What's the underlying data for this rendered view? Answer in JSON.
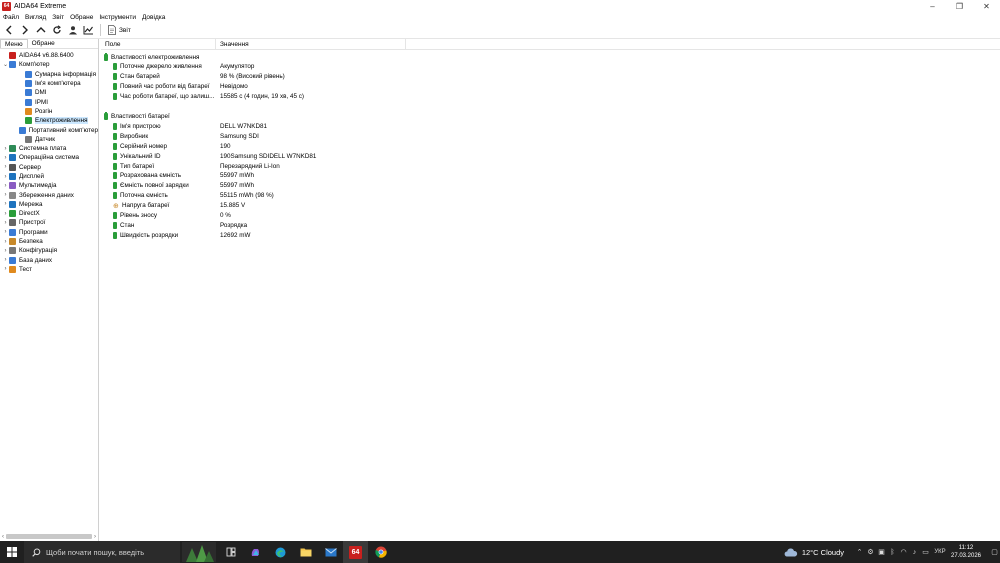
{
  "window": {
    "title": "AIDA64 Extreme",
    "icon_text": "64"
  },
  "menu": [
    "Файл",
    "Вигляд",
    "Звіт",
    "Обране",
    "Інструменти",
    "Довідка"
  ],
  "toolbar": {
    "report_label": "Звіт"
  },
  "left_pane": {
    "tabs": [
      "Меню",
      "Обране"
    ],
    "tree": [
      {
        "label": "AIDA64 v6.88.6400",
        "indent": 0,
        "expander": "",
        "icon_color": "#c8201e"
      },
      {
        "label": "Комп'ютер",
        "indent": 0,
        "expander": "⌄",
        "icon_color": "#3a7bd5"
      },
      {
        "label": "Сумарна інформація",
        "indent": 2,
        "expander": "",
        "icon_color": "#3a7bd5"
      },
      {
        "label": "Ім'я комп'ютера",
        "indent": 2,
        "expander": "",
        "icon_color": "#3a7bd5"
      },
      {
        "label": "DMI",
        "indent": 2,
        "expander": "",
        "icon_color": "#3a7bd5"
      },
      {
        "label": "IPMI",
        "indent": 2,
        "expander": "",
        "icon_color": "#3a7bd5"
      },
      {
        "label": "Розгін",
        "indent": 2,
        "expander": "",
        "icon_color": "#e08a1e"
      },
      {
        "label": "Електроживлення",
        "indent": 2,
        "expander": "",
        "icon_color": "#2a9d3a",
        "selected": true
      },
      {
        "label": "Портативний комп'ютер",
        "indent": 2,
        "expander": "",
        "icon_color": "#3a7bd5"
      },
      {
        "label": "Датчик",
        "indent": 2,
        "expander": "",
        "icon_color": "#777777"
      },
      {
        "label": "Системна плата",
        "indent": 0,
        "expander": "›",
        "icon_color": "#2e8b57"
      },
      {
        "label": "Операційна система",
        "indent": 0,
        "expander": "›",
        "icon_color": "#1e73be"
      },
      {
        "label": "Сервер",
        "indent": 0,
        "expander": "›",
        "icon_color": "#555555"
      },
      {
        "label": "Дисплей",
        "indent": 0,
        "expander": "›",
        "icon_color": "#1e73be"
      },
      {
        "label": "Мультимедіа",
        "indent": 0,
        "expander": "›",
        "icon_color": "#8a5cc2"
      },
      {
        "label": "Збереження даних",
        "indent": 0,
        "expander": "›",
        "icon_color": "#888888"
      },
      {
        "label": "Мережа",
        "indent": 0,
        "expander": "›",
        "icon_color": "#1e73be"
      },
      {
        "label": "DirectX",
        "indent": 0,
        "expander": "›",
        "icon_color": "#2a9d3a"
      },
      {
        "label": "Пристрої",
        "indent": 0,
        "expander": "›",
        "icon_color": "#666666"
      },
      {
        "label": "Програми",
        "indent": 0,
        "expander": "›",
        "icon_color": "#3a7bd5"
      },
      {
        "label": "Безпека",
        "indent": 0,
        "expander": "›",
        "icon_color": "#c8892a"
      },
      {
        "label": "Конфігурація",
        "indent": 0,
        "expander": "›",
        "icon_color": "#777777"
      },
      {
        "label": "База даних",
        "indent": 0,
        "expander": "›",
        "icon_color": "#3a7bd5"
      },
      {
        "label": "Тест",
        "indent": 0,
        "expander": "›",
        "icon_color": "#e08a1e"
      }
    ]
  },
  "columns": {
    "field": "Поле",
    "value": "Значення"
  },
  "groups": [
    {
      "title": "Властивості електроживлення",
      "rows": [
        {
          "field": "Поточне джерело живлення",
          "value": "Акумулятор",
          "icon": "battery-icon"
        },
        {
          "field": "Стан батарей",
          "value": "98 % (Високий рівень)",
          "icon": "battery-icon"
        },
        {
          "field": "Повний час роботи від батареї",
          "value": "Невідомо",
          "icon": "battery-icon"
        },
        {
          "field": "Час роботи батареї, що залиш...",
          "value": "15585 с (4 годин, 19 хв, 45 с)",
          "icon": "battery-icon"
        }
      ]
    },
    {
      "title": "Властивості батареї",
      "rows": [
        {
          "field": "Ім'я пристрою",
          "value": "DELL W7NKD81",
          "icon": "battery-icon"
        },
        {
          "field": "Виробник",
          "value": "Samsung SDI",
          "icon": "battery-icon"
        },
        {
          "field": "Серійний номер",
          "value": "190",
          "icon": "battery-icon"
        },
        {
          "field": "Унікальний ID",
          "value": "190Samsung SDIDELL W7NKD81",
          "icon": "battery-icon"
        },
        {
          "field": "Тип батареї",
          "value": "Перезарядний Li-Ion",
          "icon": "battery-icon"
        },
        {
          "field": "Розрахована ємність",
          "value": "55997 mWh",
          "icon": "battery-icon"
        },
        {
          "field": "Ємність повної зарядки",
          "value": "55997 mWh",
          "icon": "battery-icon"
        },
        {
          "field": "Поточна ємність",
          "value": "55115 mWh  (98 %)",
          "icon": "battery-icon"
        },
        {
          "field": "Напруга батареї",
          "value": "15.885 V",
          "icon": "voltage-icon"
        },
        {
          "field": "Рівень зносу",
          "value": "0 %",
          "icon": "battery-icon"
        },
        {
          "field": "Стан",
          "value": "Розрядка",
          "icon": "battery-icon"
        },
        {
          "field": "Швидкість розрядки",
          "value": "12692 mW",
          "icon": "battery-icon"
        }
      ]
    }
  ],
  "taskbar": {
    "search_placeholder": "Щоби почати пошук, введіть",
    "weather": "12°C  Cloudy",
    "language": "УКР",
    "time": "11:12",
    "date": "27.03.2026",
    "active_app_label": "64"
  }
}
